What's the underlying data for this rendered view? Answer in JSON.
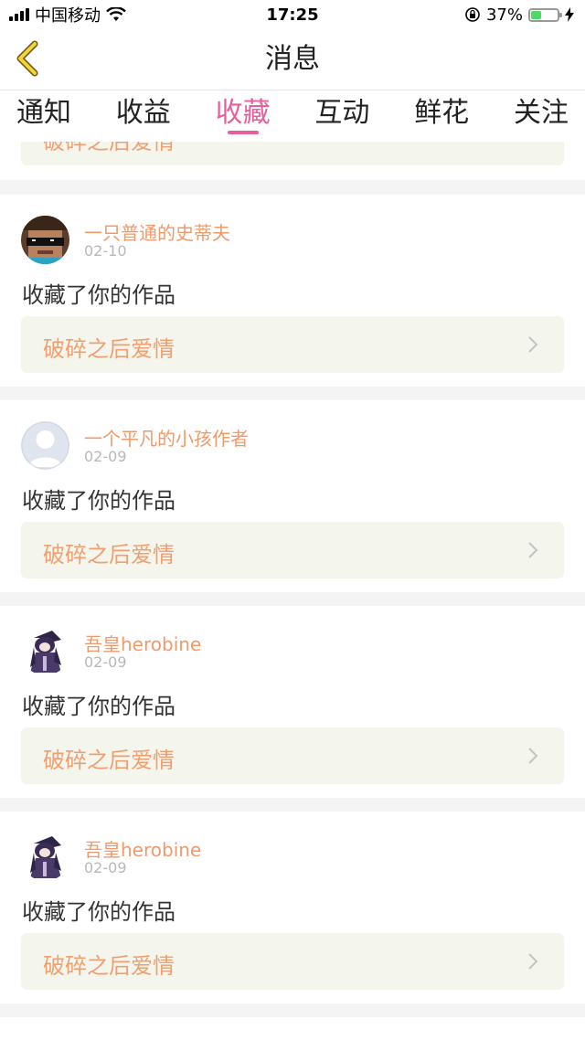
{
  "status_bar": {
    "carrier": "中国移动",
    "time": "17:25",
    "battery": "37%"
  },
  "header": {
    "title": "消息"
  },
  "tabs": [
    {
      "label": "通知",
      "active": false
    },
    {
      "label": "收益",
      "active": false
    },
    {
      "label": "收藏",
      "active": true
    },
    {
      "label": "互动",
      "active": false
    },
    {
      "label": "鲜花",
      "active": false
    },
    {
      "label": "关注",
      "active": false
    }
  ],
  "partial_item": {
    "work_title": "破碎之后爱情"
  },
  "items": [
    {
      "username": "一只普通的史蒂夫",
      "date": "02-10",
      "action": "收藏了你的作品",
      "work_title": "破碎之后爱情",
      "avatar": "steve-avatar"
    },
    {
      "username": "一个平凡的小孩作者",
      "date": "02-09",
      "action": "收藏了你的作品",
      "work_title": "破碎之后爱情",
      "avatar": "default-avatar"
    },
    {
      "username": "吾皇herobine",
      "date": "02-09",
      "action": "收藏了你的作品",
      "work_title": "破碎之后爱情",
      "avatar": "anime-avatar"
    },
    {
      "username": "吾皇herobine",
      "date": "02-09",
      "action": "收藏了你的作品",
      "work_title": "破碎之后爱情",
      "avatar": "anime-avatar"
    }
  ],
  "colors": {
    "accent": "#e85f9c",
    "username": "#f09a6a",
    "link_bg": "#f4f5ec"
  }
}
